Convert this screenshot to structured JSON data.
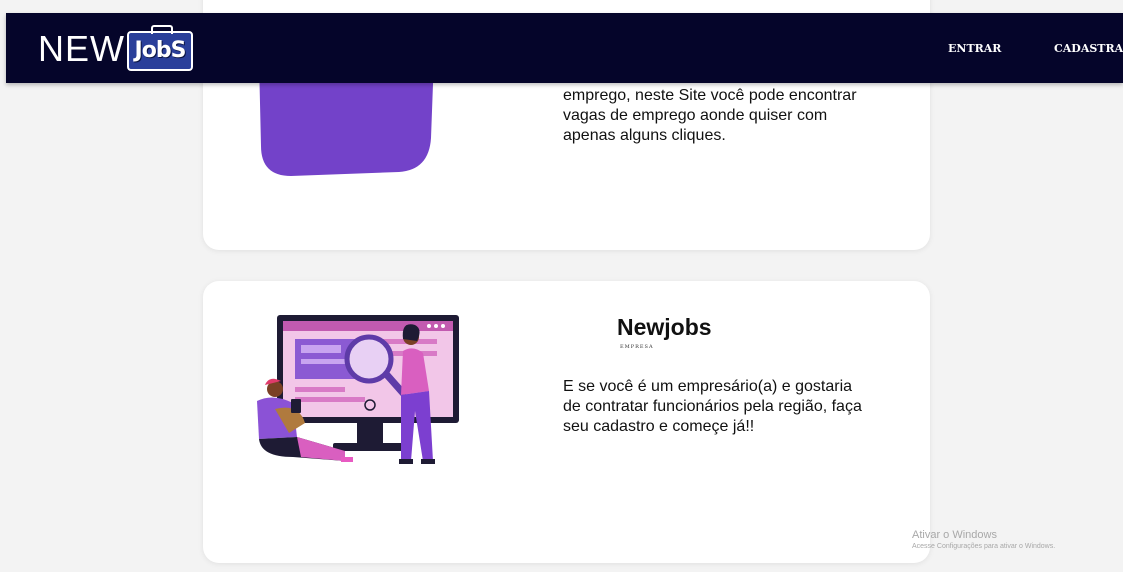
{
  "header": {
    "logo_new": "NEW",
    "logo_jobs": "JobS",
    "nav": {
      "login_label": "ENTRAR",
      "register_label": "CADASTRAR"
    }
  },
  "cards": {
    "candidate": {
      "text": "emprego, neste Site você pode encontrar vagas de emprego aonde quiser com apenas alguns cliques."
    },
    "company": {
      "title": "Newjobs",
      "subtitle": "EMPRESA",
      "text": "E se você é um empresário(a) e gostaria de contratar funcionários pela região, faça seu cadastro e começe já!!"
    }
  },
  "watermark": {
    "title": "Ativar o Windows",
    "subtitle": "Acesse Configurações para ativar o Windows."
  },
  "colors": {
    "header_bg": "#05052a",
    "page_bg": "#f3f3f3",
    "accent_purple": "#7b3fc8",
    "accent_pink": "#e05db8"
  }
}
